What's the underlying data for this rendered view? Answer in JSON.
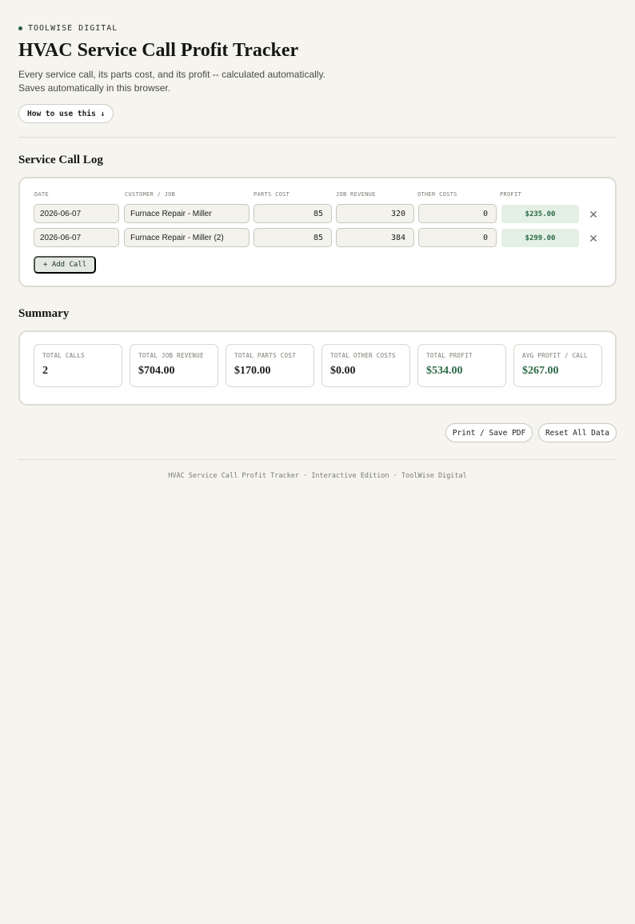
{
  "brand": {
    "name": "TOOLWISE DIGITAL"
  },
  "header": {
    "title": "HVAC Service Call Profit Tracker",
    "subtitle": "Every service call, its parts cost, and its profit -- calculated automatically. Saves automatically in this browser.",
    "howto_label": "How to use this ↓"
  },
  "log": {
    "section_title": "Service Call Log",
    "columns": {
      "date": "DATE",
      "customer": "CUSTOMER / JOB",
      "parts": "PARTS COST",
      "revenue": "JOB REVENUE",
      "other": "OTHER COSTS",
      "profit": "PROFIT"
    },
    "rows": [
      {
        "date": "2026-06-07",
        "customer": "Furnace Repair - Miller",
        "parts": "85",
        "revenue": "320",
        "other": "0",
        "profit": "$235.00"
      },
      {
        "date": "2026-06-07",
        "customer": "Furnace Repair - Miller (2)",
        "parts": "85",
        "revenue": "384",
        "other": "0",
        "profit": "$299.00"
      }
    ],
    "remove_glyph": "✕",
    "add_label": "+ Add Call"
  },
  "summary": {
    "section_title": "Summary",
    "stats": [
      {
        "label": "TOTAL CALLS",
        "value": "2"
      },
      {
        "label": "TOTAL JOB REVENUE",
        "value": "$704.00"
      },
      {
        "label": "TOTAL PARTS COST",
        "value": "$170.00"
      },
      {
        "label": "TOTAL OTHER COSTS",
        "value": "$0.00"
      },
      {
        "label": "TOTAL PROFIT",
        "value": "$534.00"
      },
      {
        "label": "AVG PROFIT / CALL",
        "value": "$267.00"
      }
    ]
  },
  "actions": {
    "print_label": "Print / Save PDF",
    "reset_label": "Reset All Data"
  },
  "footer": {
    "text": "HVAC Service Call Profit Tracker · Interactive Edition · ToolWise Digital"
  },
  "colors": {
    "accent_green": "#2c6a44",
    "background": "#f5f4ef",
    "profit_bg": "#e3f0e5"
  }
}
